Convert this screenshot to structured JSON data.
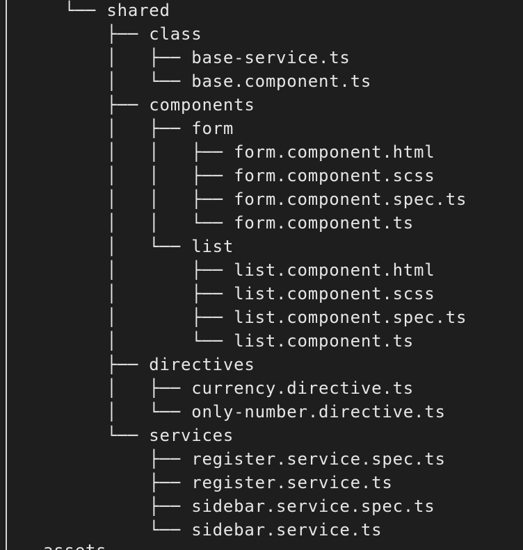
{
  "tree": {
    "lines": [
      "  └── shared",
      "      ├── class",
      "      │   ├── base-service.ts",
      "      │   └── base.component.ts",
      "      ├── components",
      "      │   ├── form",
      "      │   │   ├── form.component.html",
      "      │   │   ├── form.component.scss",
      "      │   │   ├── form.component.spec.ts",
      "      │   │   └── form.component.ts",
      "      │   └── list",
      "      │       ├── list.component.html",
      "      │       ├── list.component.scss",
      "      │       ├── list.component.spec.ts",
      "      │       └── list.component.ts",
      "      ├── directives",
      "      │   ├── currency.directive.ts",
      "      │   └── only-number.directive.ts",
      "      └── services",
      "          ├── register.service.spec.ts",
      "          ├── register.service.ts",
      "          ├── sidebar.service.spec.ts",
      "          └── sidebar.service.ts"
    ],
    "cut_off_line": "assets"
  }
}
